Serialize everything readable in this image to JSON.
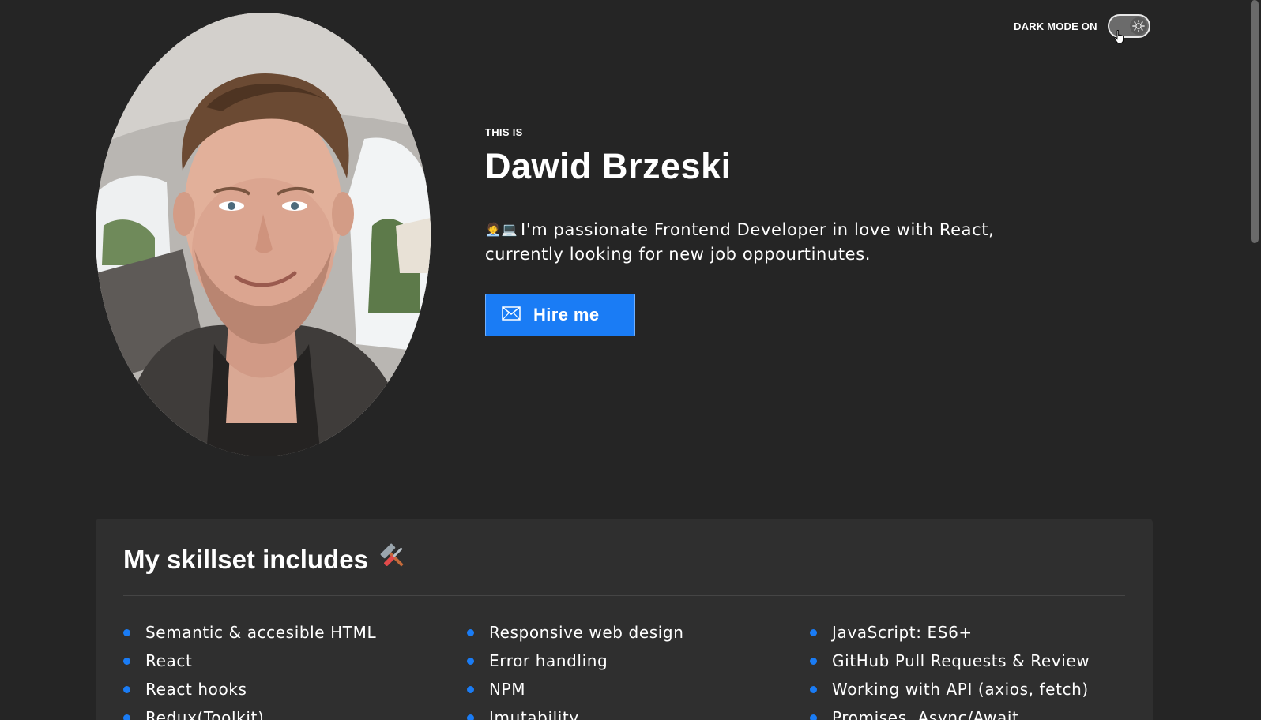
{
  "header": {
    "mode_label": "DARK MODE ON",
    "toggle_icon": "sun-icon",
    "dark_mode_enabled": true
  },
  "hero": {
    "eyebrow": "THIS IS",
    "name": "Dawid Brzeski",
    "bio_emoji": "🧑‍💼💻",
    "bio": "I'm passionate Frontend Developer in love with React, currently looking for new job oppourtinutes.",
    "hire_label": "Hire me",
    "hire_icon": "envelope-icon"
  },
  "skills": {
    "title": "My skillset includes",
    "title_emoji": "tools-icon",
    "columns": [
      [
        "Semantic & accesible HTML",
        "React",
        "React hooks",
        "Redux(Toolkit)"
      ],
      [
        "Responsive web design",
        "Error handling",
        "NPM",
        "Imutability"
      ],
      [
        "JavaScript: ES6+",
        "GitHub Pull Requests & Review",
        "Working with API (axios, fetch)",
        "Promises, Async/Await"
      ]
    ]
  },
  "colors": {
    "background": "#252525",
    "card": "#2f2f2f",
    "accent": "#1a7cf5"
  }
}
